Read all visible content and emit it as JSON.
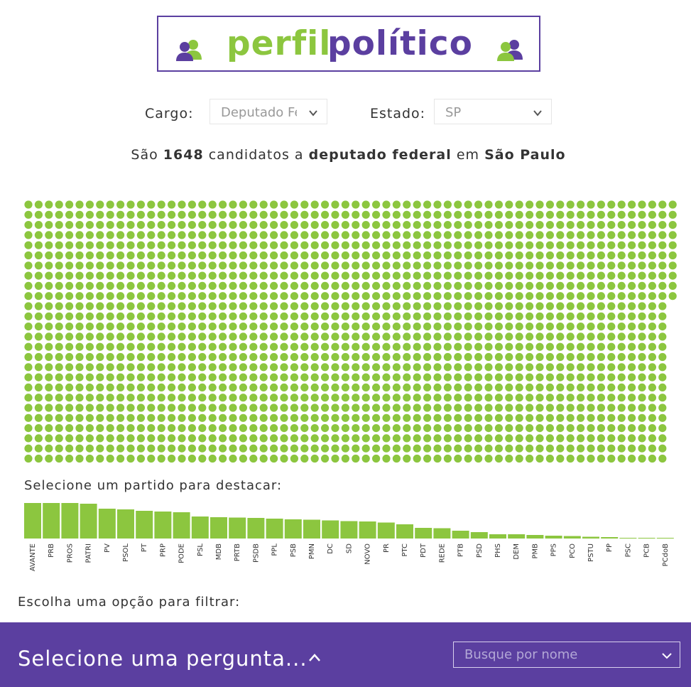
{
  "logo": {
    "word1": "perfil",
    "word2": "político"
  },
  "filters": {
    "cargo_label": "Cargo:",
    "cargo_value": "Deputado Federal",
    "estado_label": "Estado:",
    "estado_value": "SP"
  },
  "summary": {
    "prefix": "São",
    "count": "1648",
    "middle": "candidatos a",
    "office": "deputado federal",
    "connector": "em",
    "state": "São Paulo"
  },
  "party_prompt": "Selecione um partido para destacar:",
  "filter_prompt": "Escolha uma opção para filtrar:",
  "footer": {
    "question": "Selecione uma pergunta...",
    "search_placeholder": "Busque por nome"
  },
  "colors": {
    "accent_green": "#8cc63f",
    "brand_purple": "#5b3fa0"
  },
  "icons": {
    "logo_left": "person-pair-icon",
    "logo_right": "person-pair-icon",
    "dropdown": "chevron-down-icon",
    "question_toggle": "chevron-up-icon"
  },
  "chart_data": {
    "type": "bar",
    "categories": [
      "AVANTE",
      "PRB",
      "PROS",
      "PATRI",
      "PV",
      "PSOL",
      "PT",
      "PRP",
      "PODE",
      "PSL",
      "MDB",
      "PRTB",
      "PSDB",
      "PPL",
      "PSB",
      "PMN",
      "DC",
      "SD",
      "NOVO",
      "PR",
      "PTC",
      "PDT",
      "REDE",
      "PTB",
      "PSD",
      "PHS",
      "DEM",
      "PMB",
      "PPS",
      "PCO",
      "PSTU",
      "PP",
      "PSC",
      "PCB",
      "PCdoB"
    ],
    "values": [
      100,
      100,
      100,
      98,
      84,
      82,
      78,
      76,
      74,
      62,
      60,
      59,
      58,
      56,
      54,
      53,
      51,
      49,
      48,
      45,
      40,
      30,
      29,
      22,
      18,
      12,
      12,
      10,
      8,
      7,
      5,
      4,
      2,
      1,
      1
    ],
    "dot_grid": {
      "rows": 26,
      "cols": 64,
      "full_cols": 63,
      "total": 1648
    }
  }
}
